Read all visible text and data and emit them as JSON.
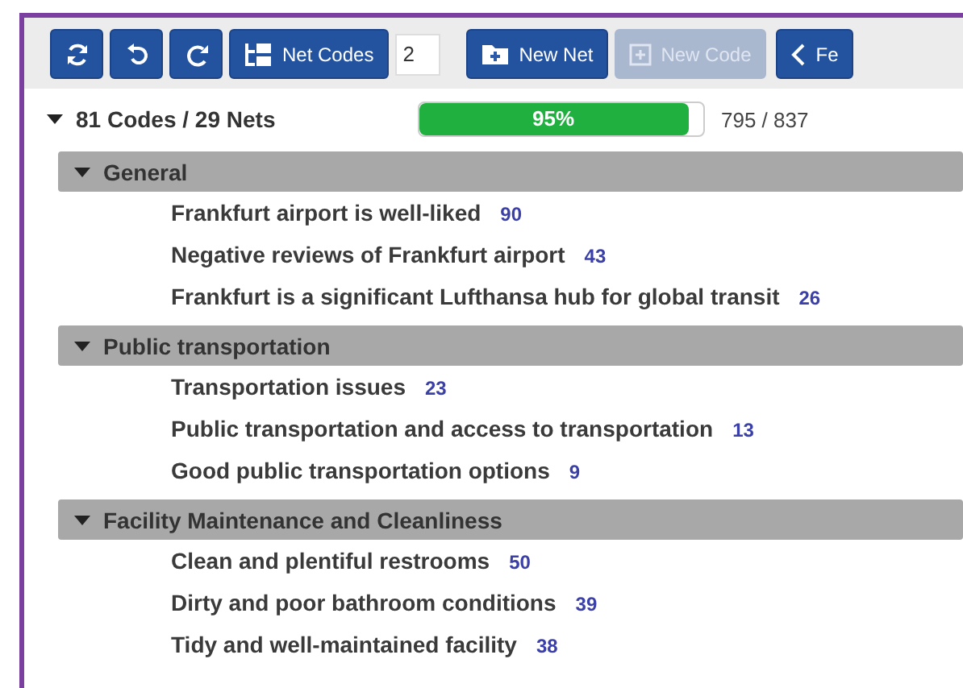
{
  "toolbar": {
    "buttons": [
      {
        "kind": "refresh",
        "disabled": false
      },
      {
        "kind": "undo",
        "disabled": false
      },
      {
        "kind": "redo",
        "disabled": false
      },
      {
        "kind": "netcodes",
        "label": "Net Codes",
        "disabled": false
      },
      {
        "kind": "input",
        "value": "2"
      },
      {
        "kind": "newnet",
        "label": "New Net",
        "disabled": false
      },
      {
        "kind": "newcode",
        "label": "New Code",
        "disabled": true
      },
      {
        "kind": "back",
        "label": "Fe",
        "disabled": false
      }
    ]
  },
  "summary": {
    "expanded": true,
    "label": "81 Codes / 29 Nets",
    "progress": {
      "level": 0.95,
      "label": "95%"
    },
    "count": "795 / 837"
  },
  "groups": [
    {
      "name": "General",
      "expanded": true,
      "items": [
        {
          "label": "Frankfurt airport is well-liked",
          "count": "90"
        },
        {
          "label": "Negative reviews of Frankfurt airport",
          "count": "43"
        },
        {
          "label": "Frankfurt is a significant Lufthansa hub for global transit",
          "count": "26"
        }
      ]
    },
    {
      "name": "Public transportation",
      "expanded": true,
      "items": [
        {
          "label": "Transportation issues",
          "count": "23"
        },
        {
          "label": "Public transportation and access to transportation",
          "count": "13"
        },
        {
          "label": "Good public transportation options",
          "count": "9"
        }
      ]
    },
    {
      "name": "Facility Maintenance and Cleanliness",
      "expanded": true,
      "items": [
        {
          "label": "Clean and plentiful restrooms",
          "count": "50"
        },
        {
          "label": "Dirty and poor bathroom conditions",
          "count": "39"
        },
        {
          "label": "Tidy and well-maintained facility",
          "count": "38"
        }
      ]
    }
  ]
}
